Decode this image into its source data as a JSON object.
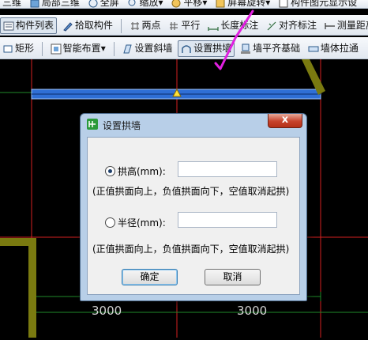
{
  "toolbar_top": {
    "items": [
      {
        "label": "三维",
        "icon": "cube-icon"
      },
      {
        "label": "局部三维",
        "icon": "local-3d-icon"
      },
      {
        "label": "全屏",
        "icon": "fullscreen-icon"
      },
      {
        "label": "缩放",
        "icon": "zoom-icon"
      },
      {
        "label": "平移",
        "icon": "pan-icon"
      },
      {
        "label": "屏幕旋转",
        "icon": "rotate-icon"
      },
      {
        "label": "构件图元显示设",
        "icon": "display-settings-icon"
      }
    ]
  },
  "toolbar_mid": {
    "items": [
      {
        "label": "构件列表",
        "icon": "component-list-icon",
        "pressed": true
      },
      {
        "label": "拾取构件",
        "icon": "pick-icon"
      },
      {
        "label": "两点",
        "icon": "two-point-icon"
      },
      {
        "label": "平行",
        "icon": "parallel-icon"
      },
      {
        "label": "长度标注",
        "icon": "length-dim-icon"
      },
      {
        "label": "对齐标注",
        "icon": "align-dim-icon"
      },
      {
        "label": "测量距离",
        "icon": "measure-icon"
      }
    ]
  },
  "toolbar_draw": {
    "items": [
      {
        "label": "矩形",
        "icon": "rectangle-icon"
      },
      {
        "label": "智能布置",
        "icon": "smart-layout-icon",
        "dropdown": true
      },
      {
        "label": "设置斜墙",
        "icon": "slant-wall-icon"
      },
      {
        "label": "设置拱墙",
        "icon": "arch-wall-icon",
        "pressed": true
      },
      {
        "label": "墙平齐基础",
        "icon": "wall-align-icon"
      },
      {
        "label": "墙体拉通",
        "icon": "wall-extend-icon"
      }
    ]
  },
  "canvas": {
    "dimensions": [
      "3000",
      "3000"
    ]
  },
  "dialog": {
    "title": "设置拱墙",
    "close_label": "x",
    "height_option": {
      "label": "拱高(mm):",
      "value": "",
      "selected": true
    },
    "height_hint": "(正值拱面向上，负值拱面向下，空值取消起拱)",
    "radius_option": {
      "label": "半径(mm):",
      "value": "",
      "selected": false
    },
    "radius_hint": "(正值拱面向上，负值拱面向下，空值取消起拱)",
    "ok_label": "确定",
    "cancel_label": "取消"
  },
  "colors": {
    "canvas_bg": "#000000",
    "grid_red": "#d42020",
    "grid_green": "#1f8a2a",
    "wall_blue": "#2f6fd6",
    "wall_olive": "#7a7a10",
    "annotation_magenta": "#e020e0"
  }
}
